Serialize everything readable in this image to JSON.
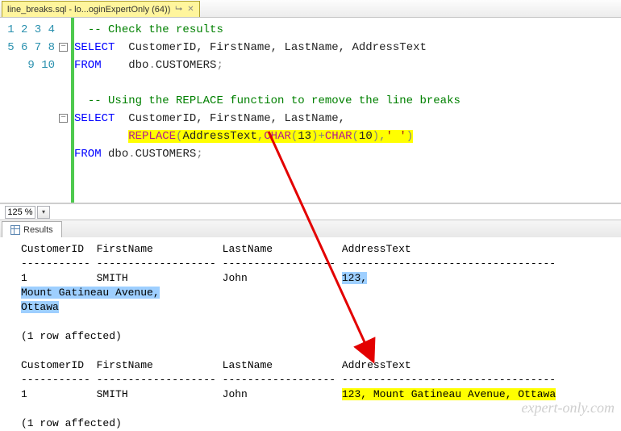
{
  "tab": {
    "title": "line_breaks.sql - lo...oginExpertOnly (64))"
  },
  "zoom": "125 %",
  "resultsTabLabel": "Results",
  "code": {
    "comment1": "-- Check the results",
    "comment2": "-- Using the REPLACE function to remove the line breaks",
    "kw_select": "SELECT",
    "kw_from": "FROM",
    "cols1": "CustomerID, FirstName, LastName, AddressText",
    "from1": "dbo.CUSTOMERS;",
    "cols2": "CustomerID, FirstName, LastName,",
    "replace_call": "REPLACE(AddressText,CHAR(13)+CHAR(10),' ')",
    "from2": "dbo.CUSTOMERS;",
    "str_space": "' '",
    "paren_o": "(",
    "paren_c": ")",
    "comma": ",",
    "plus": "+",
    "char13": "CHAR(13)",
    "char10": "CHAR(10)",
    "func_replace": "REPLACE",
    "arg1": "AddressText",
    "dot": "."
  },
  "res": {
    "header": "CustomerID  FirstName           LastName           AddressText",
    "dashes": "----------- ------------------- ------------------ ----------------------------------",
    "row1_a": "1           SMITH               John               ",
    "row1_addr_l1": "123,",
    "row1_addr_l2": "Mount Gatineau Avenue,",
    "row1_addr_l3": "Ottawa",
    "affected": "(1 row affected)",
    "row2_a": "1           SMITH               John               ",
    "row2_addr": "123, Mount Gatineau Avenue, Ottawa"
  },
  "watermark": "expert-only.com"
}
